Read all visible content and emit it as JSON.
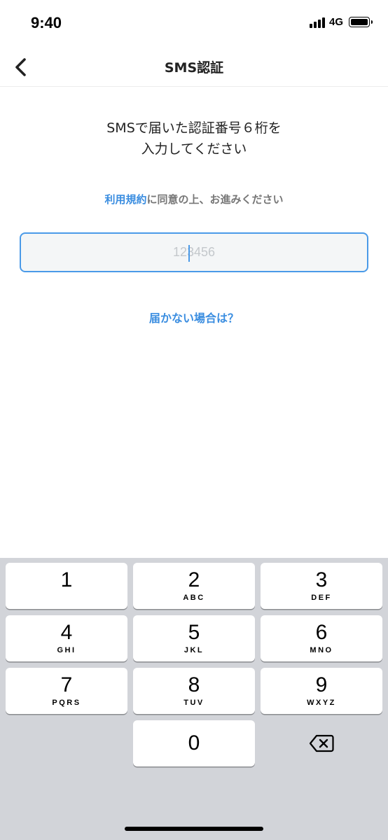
{
  "status_bar": {
    "time": "9:40",
    "network": "4G"
  },
  "nav": {
    "title": "SMS認証",
    "back_icon": "chevron-left-icon"
  },
  "content": {
    "instruction_line1": "SMSで届いた認証番号６桁を",
    "instruction_line2": "入力してください",
    "terms_link": "利用規約",
    "terms_rest": "に同意の上、お進みください",
    "code_value": "",
    "code_placeholder": "123456",
    "help_link": "届かない場合は？"
  },
  "keypad": {
    "keys": [
      {
        "digit": "1",
        "letters": ""
      },
      {
        "digit": "2",
        "letters": "ABC"
      },
      {
        "digit": "3",
        "letters": "DEF"
      },
      {
        "digit": "4",
        "letters": "GHI"
      },
      {
        "digit": "5",
        "letters": "JKL"
      },
      {
        "digit": "6",
        "letters": "MNO"
      },
      {
        "digit": "7",
        "letters": "PQRS"
      },
      {
        "digit": "8",
        "letters": "TUV"
      },
      {
        "digit": "9",
        "letters": "WXYZ"
      },
      {
        "digit": "0",
        "letters": ""
      }
    ],
    "delete_icon": "backspace-icon"
  },
  "colors": {
    "accent": "#3a8de0",
    "keypad_bg": "#d2d4d9",
    "field_border": "#4a9ae8"
  }
}
